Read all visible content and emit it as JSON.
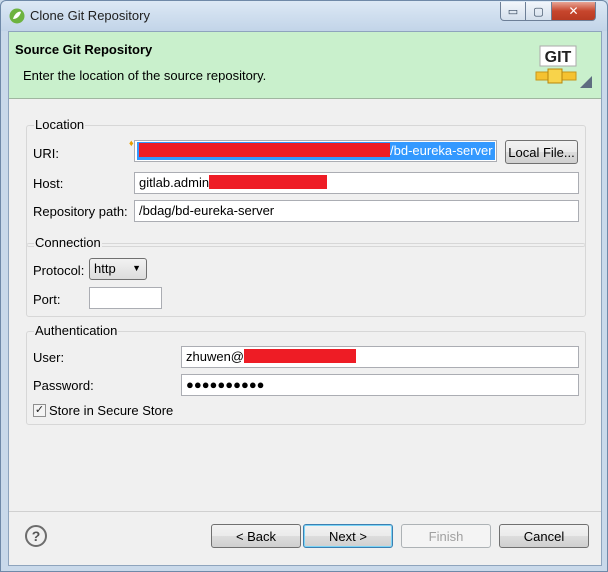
{
  "window": {
    "title": "Clone Git Repository"
  },
  "controls": {
    "min": "▭",
    "max": "▢",
    "close": "✕"
  },
  "banner": {
    "title": "Source Git Repository",
    "description": "Enter the location of the source repository.",
    "logo_text": "GIT"
  },
  "location": {
    "group_label": "Location",
    "uri_label": "URI:",
    "uri_value_visible": "/bd-eureka-server",
    "local_file_button": "Local File...",
    "host_label": "Host:",
    "host_value_visible": "gitlab.admin",
    "repo_path_label": "Repository path:",
    "repo_path_value": "/bdag/bd-eureka-server"
  },
  "connection": {
    "group_label": "Connection",
    "protocol_label": "Protocol:",
    "protocol_value": "http",
    "port_label": "Port:",
    "port_value": ""
  },
  "authentication": {
    "group_label": "Authentication",
    "user_label": "User:",
    "user_value_visible": "zhuwen@",
    "password_label": "Password:",
    "password_value": "●●●●●●●●●●",
    "store_label": "Store in Secure Store",
    "store_checked": "✓"
  },
  "footer": {
    "help": "?",
    "back": "< Back",
    "next": "Next >",
    "finish": "Finish",
    "cancel": "Cancel"
  },
  "icons": [
    "spring-app-icon",
    "git-logo-icon",
    "help-icon",
    "dropdown-arrow-icon",
    "checkmark-icon"
  ],
  "colors": {
    "banner_bg": "#c9f0cc",
    "selection": "#3399ff",
    "redaction": "#ee1c25"
  }
}
